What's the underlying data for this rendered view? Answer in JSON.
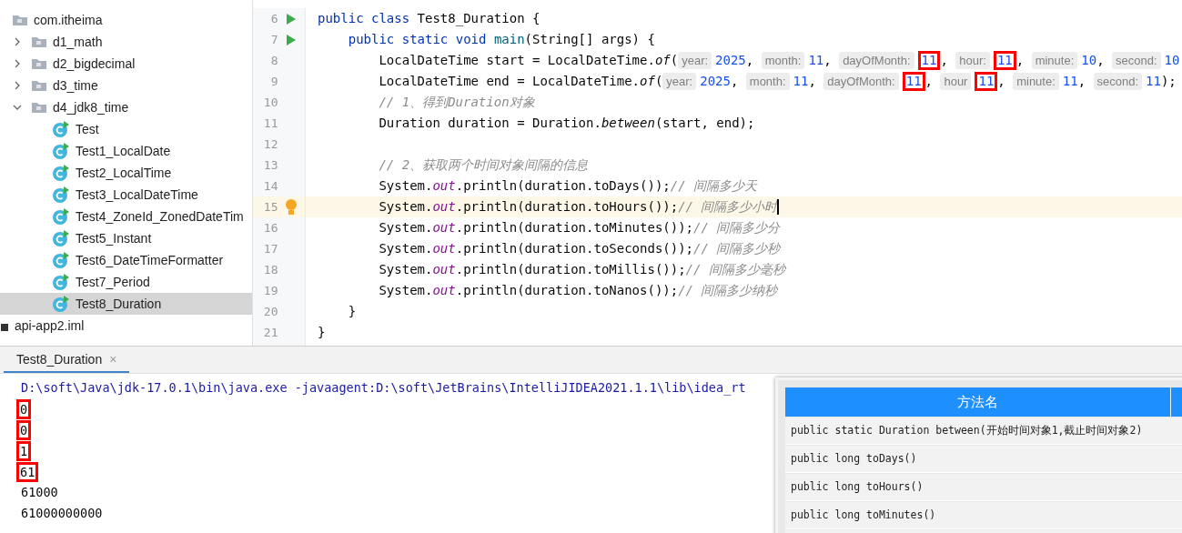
{
  "project_tree": [
    {
      "label": "com.itheima",
      "kind": "package",
      "selected": false,
      "children": [
        {
          "label": "d1_math",
          "kind": "package",
          "expanded": false,
          "selected": false
        },
        {
          "label": "d2_bigdecimal",
          "kind": "package",
          "expanded": false,
          "selected": false
        },
        {
          "label": "d3_time",
          "kind": "package",
          "expanded": false,
          "selected": false
        },
        {
          "label": "d4_jdk8_time",
          "kind": "package",
          "expanded": true,
          "selected": false,
          "children": [
            {
              "label": "Test",
              "kind": "class",
              "selected": false
            },
            {
              "label": "Test1_LocalDate",
              "kind": "class",
              "selected": false
            },
            {
              "label": "Test2_LocalTime",
              "kind": "class",
              "selected": false
            },
            {
              "label": "Test3_LocalDateTime",
              "kind": "class",
              "selected": false
            },
            {
              "label": "Test4_ZoneId_ZonedDateTim",
              "kind": "class",
              "selected": false
            },
            {
              "label": "Test5_Instant",
              "kind": "class",
              "selected": false
            },
            {
              "label": "Test6_DateTimeFormatter",
              "kind": "class",
              "selected": false
            },
            {
              "label": "Test7_Period",
              "kind": "class",
              "selected": false
            },
            {
              "label": "Test8_Duration",
              "kind": "class",
              "selected": true
            }
          ]
        }
      ]
    },
    {
      "label": "api-app2.iml",
      "kind": "file",
      "selected": false
    }
  ],
  "editor": {
    "lines": [
      {
        "number": "6",
        "runnable": true,
        "tokens": [
          {
            "kind": "kw",
            "text": "public class "
          },
          {
            "kind": "plain",
            "text": "Test8_Duration {"
          }
        ]
      },
      {
        "number": "7",
        "runnable": true,
        "tokens": [
          {
            "kind": "kw",
            "text": "    public static void "
          },
          {
            "kind": "method",
            "text": "main"
          },
          {
            "kind": "plain",
            "text": "(String[] args) {"
          }
        ]
      },
      {
        "number": "8",
        "tokens": [
          {
            "kind": "plain",
            "text": "        LocalDateTime start = LocalDateTime."
          },
          {
            "kind": "static",
            "text": "of"
          },
          {
            "kind": "plain",
            "text": "("
          },
          {
            "kind": "hint",
            "text": "year:"
          },
          {
            "kind": "num",
            "text": "2025"
          },
          {
            "kind": "plain",
            "text": ", "
          },
          {
            "kind": "hint",
            "text": "month:"
          },
          {
            "kind": "num",
            "text": "11"
          },
          {
            "kind": "plain",
            "text": ", "
          },
          {
            "kind": "hint",
            "text": "dayOfMonth:"
          },
          {
            "kind": "num",
            "text": "11",
            "boxed": true
          },
          {
            "kind": "plain",
            "text": ", "
          },
          {
            "kind": "hint",
            "text": "hour:"
          },
          {
            "kind": "num",
            "text": "11",
            "boxed": true
          },
          {
            "kind": "plain",
            "text": ", "
          },
          {
            "kind": "hint",
            "text": "minute:"
          },
          {
            "kind": "num",
            "text": "10"
          },
          {
            "kind": "plain",
            "text": ", "
          },
          {
            "kind": "hint",
            "text": "second:"
          },
          {
            "kind": "num",
            "text": "10"
          }
        ]
      },
      {
        "number": "9",
        "tokens": [
          {
            "kind": "plain",
            "text": "        LocalDateTime end = LocalDateTime."
          },
          {
            "kind": "static",
            "text": "of"
          },
          {
            "kind": "plain",
            "text": "("
          },
          {
            "kind": "hint",
            "text": "year:"
          },
          {
            "kind": "num",
            "text": "2025"
          },
          {
            "kind": "plain",
            "text": ", "
          },
          {
            "kind": "hint",
            "text": "month:"
          },
          {
            "kind": "num",
            "text": "11"
          },
          {
            "kind": "plain",
            "text": ", "
          },
          {
            "kind": "hint",
            "text": "dayOfMonth:"
          },
          {
            "kind": "num",
            "text": "11",
            "boxed": true
          },
          {
            "kind": "plain",
            "text": ", "
          },
          {
            "kind": "hint",
            "text": "hour"
          },
          {
            "kind": "num",
            "text": "11",
            "boxed": true
          },
          {
            "kind": "plain",
            "text": ", "
          },
          {
            "kind": "hint",
            "text": "minute:"
          },
          {
            "kind": "num",
            "text": "11"
          },
          {
            "kind": "plain",
            "text": ", "
          },
          {
            "kind": "hint",
            "text": "second:"
          },
          {
            "kind": "num",
            "text": "11"
          },
          {
            "kind": "plain",
            "text": ");"
          }
        ]
      },
      {
        "number": "10",
        "tokens": [
          {
            "kind": "comment",
            "text": "        // 1、得到Duration对象"
          }
        ]
      },
      {
        "number": "11",
        "tokens": [
          {
            "kind": "plain",
            "text": "        Duration duration = Duration."
          },
          {
            "kind": "static",
            "text": "between"
          },
          {
            "kind": "plain",
            "text": "(start, end);"
          }
        ]
      },
      {
        "number": "12"
      },
      {
        "number": "13",
        "tokens": [
          {
            "kind": "comment",
            "text": "        // 2、获取两个时间对象间隔的信息"
          }
        ]
      },
      {
        "number": "14",
        "tokens": [
          {
            "kind": "plain",
            "text": "        System."
          },
          {
            "kind": "field",
            "text": "out"
          },
          {
            "kind": "plain",
            "text": ".println(duration.toDays());"
          },
          {
            "kind": "comment",
            "text": "// 间隔多少天"
          }
        ]
      },
      {
        "number": "15",
        "bulb": true,
        "current": true,
        "caret": true,
        "tokens": [
          {
            "kind": "plain",
            "text": "        System."
          },
          {
            "kind": "field",
            "text": "out"
          },
          {
            "kind": "plain",
            "text": ".println(duration.toHours());"
          },
          {
            "kind": "comment",
            "text": "// 间隔多少小时"
          }
        ]
      },
      {
        "number": "16",
        "tokens": [
          {
            "kind": "plain",
            "text": "        System."
          },
          {
            "kind": "field",
            "text": "out"
          },
          {
            "kind": "plain",
            "text": ".println(duration.toMinutes());"
          },
          {
            "kind": "comment",
            "text": "// 间隔多少分"
          }
        ]
      },
      {
        "number": "17",
        "tokens": [
          {
            "kind": "plain",
            "text": "        System."
          },
          {
            "kind": "field",
            "text": "out"
          },
          {
            "kind": "plain",
            "text": ".println(duration.toSeconds());"
          },
          {
            "kind": "comment",
            "text": "// 间隔多少秒"
          }
        ]
      },
      {
        "number": "18",
        "tokens": [
          {
            "kind": "plain",
            "text": "        System."
          },
          {
            "kind": "field",
            "text": "out"
          },
          {
            "kind": "plain",
            "text": ".println(duration.toMillis());"
          },
          {
            "kind": "comment",
            "text": "// 间隔多少毫秒"
          }
        ]
      },
      {
        "number": "19",
        "tokens": [
          {
            "kind": "plain",
            "text": "        System."
          },
          {
            "kind": "field",
            "text": "out"
          },
          {
            "kind": "plain",
            "text": ".println(duration.toNanos());"
          },
          {
            "kind": "comment",
            "text": "// 间隔多少纳秒"
          }
        ]
      },
      {
        "number": "20",
        "tokens": [
          {
            "kind": "plain",
            "text": "    }"
          }
        ]
      },
      {
        "number": "21",
        "tokens": [
          {
            "kind": "plain",
            "text": "}"
          }
        ]
      }
    ]
  },
  "run_panel": {
    "tab": {
      "label": "Test8_Duration",
      "close": "×"
    },
    "output": [
      {
        "kind": "command",
        "text": "D:\\soft\\Java\\jdk-17.0.1\\bin\\java.exe -javaagent:D:\\soft\\JetBrains\\IntelliJIDEA2021.1.1\\lib\\idea_rt",
        "boxed": false
      },
      {
        "kind": "stdout",
        "text": "0",
        "boxed": true
      },
      {
        "kind": "stdout",
        "text": "0",
        "boxed": true
      },
      {
        "kind": "stdout",
        "text": "1",
        "boxed": true
      },
      {
        "kind": "stdout",
        "text": "61",
        "boxed": true
      },
      {
        "kind": "stdout",
        "text": "61000",
        "boxed": false
      },
      {
        "kind": "stdout",
        "text": "61000000000",
        "boxed": false
      }
    ]
  },
  "reference_table": {
    "columns": [
      "方法名"
    ],
    "rows": [
      "public static Duration between(开始时间对象1,截止时间对象2)",
      "public long toDays()",
      "public long toHours()",
      "public long toMinutes()"
    ]
  }
}
